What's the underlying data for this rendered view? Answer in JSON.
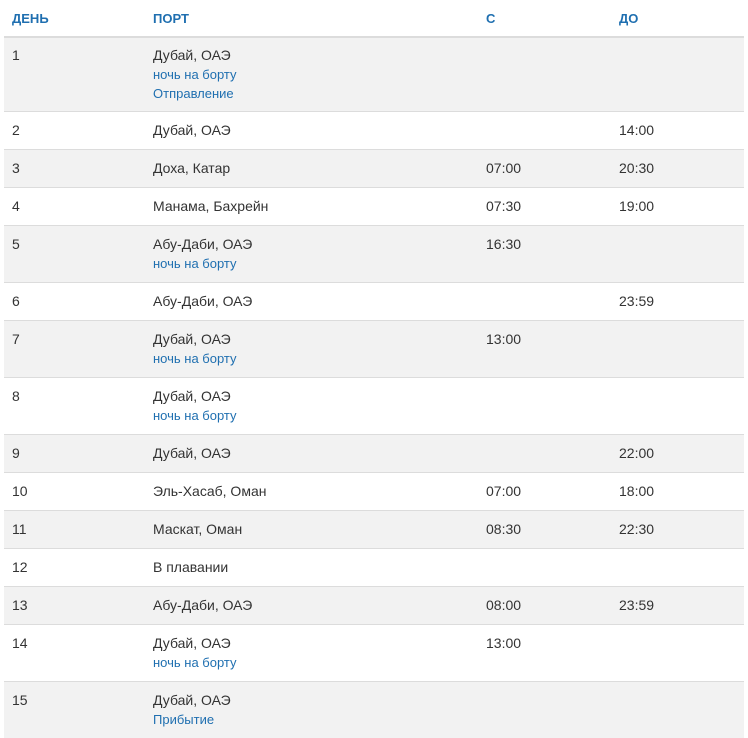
{
  "headers": {
    "day": "ДЕНЬ",
    "port": "ПОРТ",
    "from": "С",
    "to": "ДО"
  },
  "rows": [
    {
      "day": "1",
      "port": "Дубай, ОАЭ",
      "notes": [
        "ночь на борту",
        "Отправление"
      ],
      "from": "",
      "to": ""
    },
    {
      "day": "2",
      "port": "Дубай, ОАЭ",
      "notes": [],
      "from": "",
      "to": "14:00"
    },
    {
      "day": "3",
      "port": "Доха, Катар",
      "notes": [],
      "from": "07:00",
      "to": "20:30"
    },
    {
      "day": "4",
      "port": "Манама, Бахрейн",
      "notes": [],
      "from": "07:30",
      "to": "19:00"
    },
    {
      "day": "5",
      "port": "Абу-Даби, ОАЭ",
      "notes": [
        "ночь на борту"
      ],
      "from": "16:30",
      "to": ""
    },
    {
      "day": "6",
      "port": "Абу-Даби, ОАЭ",
      "notes": [],
      "from": "",
      "to": "23:59"
    },
    {
      "day": "7",
      "port": "Дубай, ОАЭ",
      "notes": [
        "ночь на борту"
      ],
      "from": "13:00",
      "to": ""
    },
    {
      "day": "8",
      "port": "Дубай, ОАЭ",
      "notes": [
        "ночь на борту"
      ],
      "from": "",
      "to": ""
    },
    {
      "day": "9",
      "port": "Дубай, ОАЭ",
      "notes": [],
      "from": "",
      "to": "22:00"
    },
    {
      "day": "10",
      "port": "Эль-Хасаб, Оман",
      "notes": [],
      "from": "07:00",
      "to": "18:00"
    },
    {
      "day": "11",
      "port": "Маскат, Оман",
      "notes": [],
      "from": "08:30",
      "to": "22:30"
    },
    {
      "day": "12",
      "port": "В плавании",
      "notes": [],
      "from": "",
      "to": ""
    },
    {
      "day": "13",
      "port": "Абу-Даби, ОАЭ",
      "notes": [],
      "from": "08:00",
      "to": "23:59"
    },
    {
      "day": "14",
      "port": "Дубай, ОАЭ",
      "notes": [
        "ночь на борту"
      ],
      "from": "13:00",
      "to": ""
    },
    {
      "day": "15",
      "port": "Дубай, ОАЭ",
      "notes": [
        "Прибытие"
      ],
      "from": "",
      "to": ""
    }
  ]
}
